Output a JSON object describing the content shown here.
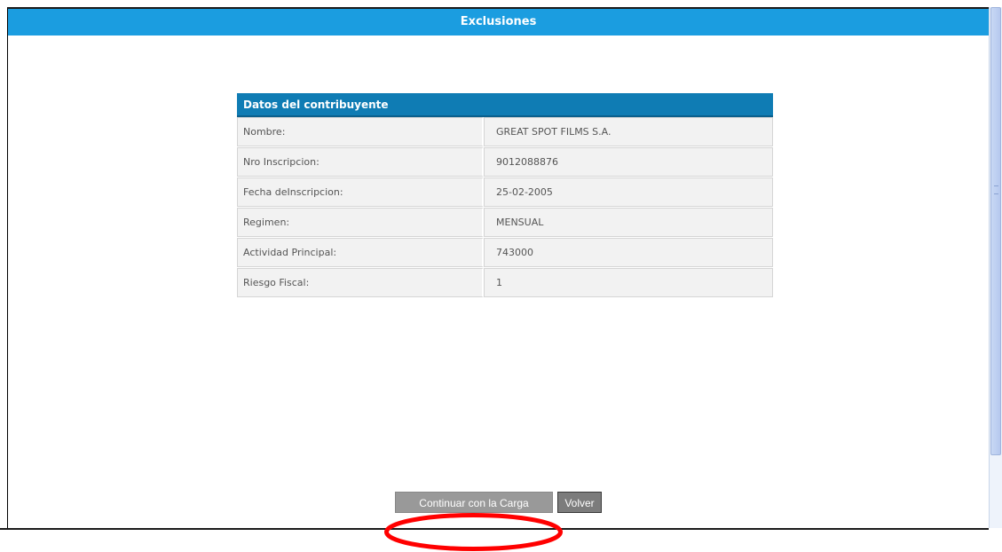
{
  "page": {
    "title": "Exclusiones"
  },
  "panel": {
    "header": "Datos del contribuyente",
    "rows": [
      {
        "label": "Nombre:",
        "value": "GREAT SPOT FILMS S.A."
      },
      {
        "label": "Nro Inscripcion:",
        "value": "9012088876"
      },
      {
        "label": "Fecha deInscripcion:",
        "value": "25-02-2005"
      },
      {
        "label": "Regimen:",
        "value": "MENSUAL"
      },
      {
        "label": "Actividad Principal:",
        "value": "743000"
      },
      {
        "label": "Riesgo Fiscal:",
        "value": "1"
      }
    ]
  },
  "buttons": {
    "continuar_label": "Continuar con la Carga",
    "volver_label": "Volver"
  },
  "colors": {
    "title_bar": "#1b9de0",
    "panel_header": "#0f7cb4",
    "annotation": "#ff0000"
  }
}
